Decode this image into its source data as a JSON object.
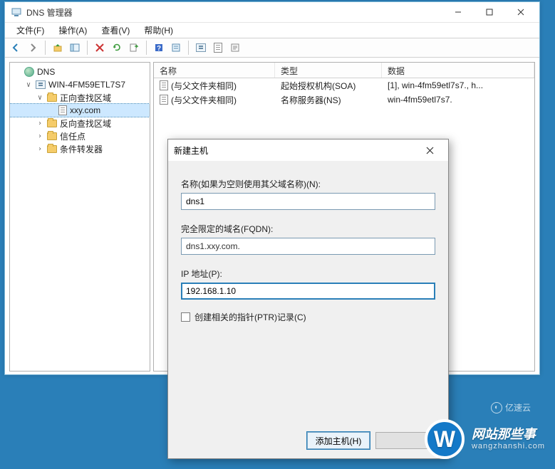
{
  "window": {
    "title": "DNS 管理器"
  },
  "menu": {
    "file": "文件(F)",
    "action": "操作(A)",
    "view": "查看(V)",
    "help": "帮助(H)"
  },
  "tree": {
    "root": "DNS",
    "server": "WIN-4FM59ETL7S7",
    "forward_zone": "正向查找区域",
    "zone_xxy": "xxy.com",
    "reverse_zone": "反向查找区域",
    "trust_points": "信任点",
    "conditional_fwd": "条件转发器"
  },
  "list": {
    "col_name": "名称",
    "col_type": "类型",
    "col_data": "数据",
    "rows": [
      {
        "name": "(与父文件夹相同)",
        "type": "起始授权机构(SOA)",
        "data": "[1], win-4fm59etl7s7., h..."
      },
      {
        "name": "(与父文件夹相同)",
        "type": "名称服务器(NS)",
        "data": "win-4fm59etl7s7."
      }
    ]
  },
  "dialog": {
    "title": "新建主机",
    "name_label": "名称(如果为空则使用其父域名称)(N):",
    "name_value": "dns1",
    "fqdn_label": "完全限定的域名(FQDN):",
    "fqdn_value": "dns1.xxy.com.",
    "ip_label": "IP 地址(P):",
    "ip_value": "192.168.1.10",
    "ptr_label": "创建相关的指针(PTR)记录(C)",
    "btn_add": "添加主机(H)",
    "btn_cancel": " "
  },
  "watermark": {
    "brand_cn": "网站那些事",
    "brand_url": "wangzhanshi.com",
    "small": "亿速云"
  }
}
